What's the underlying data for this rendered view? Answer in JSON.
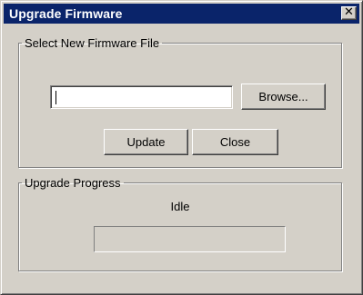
{
  "window": {
    "title": "Upgrade Firmware",
    "close_glyph": "✕"
  },
  "file_group": {
    "legend": "Select New Firmware File"
  },
  "file_input": {
    "value": "",
    "placeholder": ""
  },
  "buttons": {
    "browse": "Browse...",
    "update": "Update",
    "close": "Close"
  },
  "progress_group": {
    "legend": "Upgrade Progress",
    "status": "Idle",
    "progress_percent": 0
  },
  "colors": {
    "face": "#d4d0c8",
    "titlebar": "#0a246a",
    "titlebar_text": "#ffffff"
  }
}
